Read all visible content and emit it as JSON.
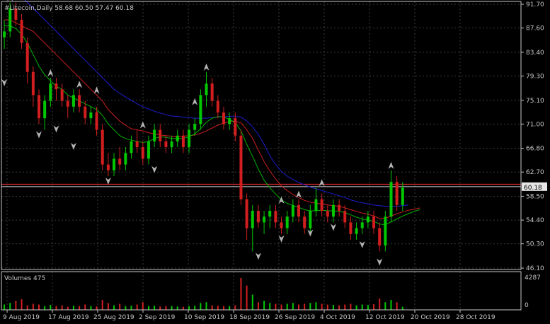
{
  "chart_data": {
    "type": "candlestick",
    "header": "#Litecoin,Daily  58.68 60.50 57.47 60.18",
    "price_badge": "60.18",
    "volume_label": "Volumes 475",
    "y_ticks": [
      "91.70",
      "87.60",
      "83.40",
      "79.30",
      "75.10",
      "71.00",
      "66.80",
      "62.70",
      "58.50",
      "54.40",
      "50.30",
      "46.10"
    ],
    "y_range": [
      46.1,
      91.7
    ],
    "volume_ticks": [
      "4287",
      "0"
    ],
    "volume_range": [
      0,
      4287
    ],
    "x_ticks": [
      "9 Aug 2019",
      "17 Aug 2019",
      "25 Aug 2019",
      "2 Sep 2019",
      "10 Sep 2019",
      "18 Sep 2019",
      "26 Sep 2019",
      "4 Oct 2019",
      "12 Oct 2019",
      "20 Oct 2019",
      "28 Oct 2019"
    ],
    "horizontal_levels": [
      {
        "name": "level-line-1",
        "value": 60.6,
        "color": "#ff3030"
      },
      {
        "name": "level-line-2",
        "value": 60.18,
        "color": "#d0d0d0"
      }
    ],
    "candles": [
      [
        86,
        89,
        84,
        87
      ],
      [
        87,
        92,
        86,
        91
      ],
      [
        91,
        92,
        88,
        89
      ],
      [
        89,
        90,
        84,
        85
      ],
      [
        85,
        86,
        78,
        80
      ],
      [
        80,
        81,
        74,
        76
      ],
      [
        76,
        77,
        71,
        72
      ],
      [
        72,
        76,
        70,
        75
      ],
      [
        75,
        79,
        74,
        78
      ],
      [
        78,
        79,
        75,
        77
      ],
      [
        77,
        78,
        74,
        75
      ],
      [
        75,
        76,
        72,
        74
      ],
      [
        74,
        77,
        73,
        76
      ],
      [
        76,
        77,
        73,
        74
      ],
      [
        74,
        75,
        71,
        72
      ],
      [
        72,
        74,
        71,
        73
      ],
      [
        73,
        74,
        69,
        70
      ],
      [
        70,
        71,
        63,
        64
      ],
      [
        64,
        66,
        62,
        63
      ],
      [
        63,
        66,
        62,
        65
      ],
      [
        65,
        67,
        63,
        64
      ],
      [
        64,
        67,
        63,
        66
      ],
      [
        66,
        69,
        65,
        68
      ],
      [
        68,
        70,
        66,
        67
      ],
      [
        67,
        68,
        64,
        65
      ],
      [
        65,
        69,
        64,
        68
      ],
      [
        68,
        71,
        67,
        70
      ],
      [
        70,
        71,
        67,
        68
      ],
      [
        68,
        69,
        66,
        67
      ],
      [
        67,
        69,
        66,
        68
      ],
      [
        68,
        70,
        67,
        69
      ],
      [
        69,
        70,
        66,
        67
      ],
      [
        67,
        71,
        66,
        70
      ],
      [
        70,
        72,
        69,
        71
      ],
      [
        71,
        77,
        70,
        76
      ],
      [
        76,
        80,
        74,
        78
      ],
      [
        78,
        79,
        74,
        75
      ],
      [
        75,
        76,
        72,
        73
      ],
      [
        73,
        74,
        70,
        71
      ],
      [
        71,
        73,
        70,
        72
      ],
      [
        72,
        73,
        68,
        69
      ],
      [
        69,
        70,
        57,
        58
      ],
      [
        58,
        59,
        51,
        53
      ],
      [
        53,
        57,
        49,
        56
      ],
      [
        56,
        57,
        53,
        54
      ],
      [
        54,
        56,
        52,
        55
      ],
      [
        55,
        57,
        53,
        56
      ],
      [
        56,
        57,
        53,
        54
      ],
      [
        54,
        55,
        52,
        53
      ],
      [
        53,
        56,
        52,
        55
      ],
      [
        55,
        58,
        54,
        57
      ],
      [
        57,
        58,
        54,
        55
      ],
      [
        55,
        56,
        52,
        53
      ],
      [
        53,
        57,
        52,
        56
      ],
      [
        56,
        60,
        55,
        58
      ],
      [
        58,
        59,
        55,
        56
      ],
      [
        56,
        57,
        54,
        55
      ],
      [
        55,
        58,
        54,
        57
      ],
      [
        57,
        58,
        55,
        56
      ],
      [
        56,
        57,
        53,
        54
      ],
      [
        54,
        55,
        51,
        52
      ],
      [
        52,
        54,
        51,
        53
      ],
      [
        53,
        55,
        52,
        54
      ],
      [
        54,
        56,
        53,
        55
      ],
      [
        55,
        56,
        52,
        53
      ],
      [
        53,
        54,
        49,
        50
      ],
      [
        50,
        56,
        49,
        55
      ],
      [
        55,
        63,
        54,
        61
      ],
      [
        61,
        62,
        56,
        57
      ],
      [
        57,
        61,
        56,
        60
      ]
    ],
    "volumes": [
      700,
      900,
      1200,
      1400,
      600,
      800,
      700,
      500,
      650,
      500,
      600,
      400,
      550,
      500,
      700,
      500,
      450,
      1300,
      900,
      600,
      800,
      500,
      550,
      700,
      1000,
      500,
      550,
      450,
      500,
      500,
      450,
      400,
      500,
      550,
      900,
      1000,
      600,
      550,
      500,
      500,
      600,
      4200,
      3200,
      2000,
      1000,
      1200,
      900,
      800,
      700,
      800,
      900,
      700,
      800,
      900,
      1000,
      800,
      700,
      650,
      600,
      700,
      800,
      600,
      700,
      650,
      750,
      1500,
      1000,
      1300,
      1000,
      400
    ],
    "ma_fast": {
      "color": "#00b400",
      "values": [
        88,
        88,
        87.5,
        86.5,
        85,
        83,
        81,
        79.5,
        78.5,
        77.5,
        77,
        76,
        75.5,
        75,
        74.5,
        74,
        73.5,
        72.5,
        71,
        70,
        69,
        68.5,
        68.2,
        68,
        67.8,
        68,
        68.5,
        68.8,
        68.7,
        68.5,
        68.5,
        68.5,
        68.8,
        69.3,
        70.2,
        71.3,
        72,
        72.3,
        72.2,
        71.8,
        71.3,
        69.8,
        67.5,
        65.4,
        63.2,
        61.3,
        60,
        58.9,
        57.9,
        57.3,
        56.9,
        56.6,
        56.2,
        56,
        56,
        56.1,
        56,
        56,
        55.9,
        55.7,
        55.3,
        54.9,
        54.6,
        54.4,
        54.2,
        53.7,
        53.6,
        54.1,
        54.6,
        55.1,
        55.5,
        55.9,
        56.2
      ]
    },
    "ma_mid": {
      "color": "#c82020",
      "values": [
        89,
        89,
        88.5,
        88,
        87.5,
        87,
        86,
        85,
        84,
        83,
        82,
        81,
        80,
        79,
        78,
        77,
        76,
        75,
        73.5,
        72.5,
        71.5,
        70.8,
        70.2,
        70,
        69.8,
        69.5,
        69.3,
        69.1,
        69,
        68.9,
        68.9,
        68.9,
        69,
        69.1,
        69.4,
        69.8,
        70.3,
        70.8,
        71.2,
        71.4,
        71.5,
        71.2,
        70,
        68.5,
        66.5,
        64.5,
        62.9,
        61.5,
        60.3,
        59.5,
        58.8,
        58.3,
        57.8,
        57.5,
        57.3,
        57.2,
        57,
        56.9,
        56.8,
        56.5,
        56.2,
        55.9,
        55.6,
        55.4,
        55.1,
        54.7,
        54.7,
        55.1,
        55.5,
        55.8,
        56.1,
        56.3,
        56.5
      ]
    },
    "ma_slow": {
      "color": "#1e1ed2",
      "values": [
        95,
        94.5,
        94,
        93,
        92,
        91,
        90,
        89,
        88,
        87,
        86,
        85,
        84,
        83,
        82,
        81,
        80,
        79,
        78,
        77,
        76.3,
        75.7,
        75.1,
        74.5,
        74,
        73.6,
        73.2,
        72.9,
        72.6,
        72.4,
        72.3,
        72.2,
        72.1,
        72,
        72,
        72,
        72.1,
        72.2,
        72.3,
        72.3,
        72.3,
        72.2,
        71.5,
        70.5,
        69.2,
        67.5,
        65.5,
        64,
        62.8,
        62,
        61.4,
        60.9,
        60.5,
        60.1,
        59.8,
        59.5,
        59.2,
        58.9,
        58.6,
        58.3,
        57.9,
        57.6,
        57.4,
        57.2,
        57,
        56.9,
        56.8,
        56.8,
        56.8,
        56.9,
        57
      ]
    },
    "fractals_up": [
      [
        1,
        92
      ],
      [
        8,
        79
      ],
      [
        13,
        77
      ],
      [
        16,
        76
      ],
      [
        24,
        70
      ],
      [
        33,
        74
      ],
      [
        35,
        80
      ],
      [
        48,
        57
      ],
      [
        51,
        58
      ],
      [
        55,
        60
      ],
      [
        67,
        63
      ]
    ],
    "fractals_down": [
      [
        0,
        79
      ],
      [
        6,
        70
      ],
      [
        9,
        71
      ],
      [
        12,
        68
      ],
      [
        18,
        62
      ],
      [
        26,
        64
      ],
      [
        44,
        49
      ],
      [
        48,
        52
      ],
      [
        53,
        53
      ],
      [
        57,
        54
      ],
      [
        62,
        51
      ],
      [
        65,
        48
      ]
    ],
    "grid": true
  }
}
